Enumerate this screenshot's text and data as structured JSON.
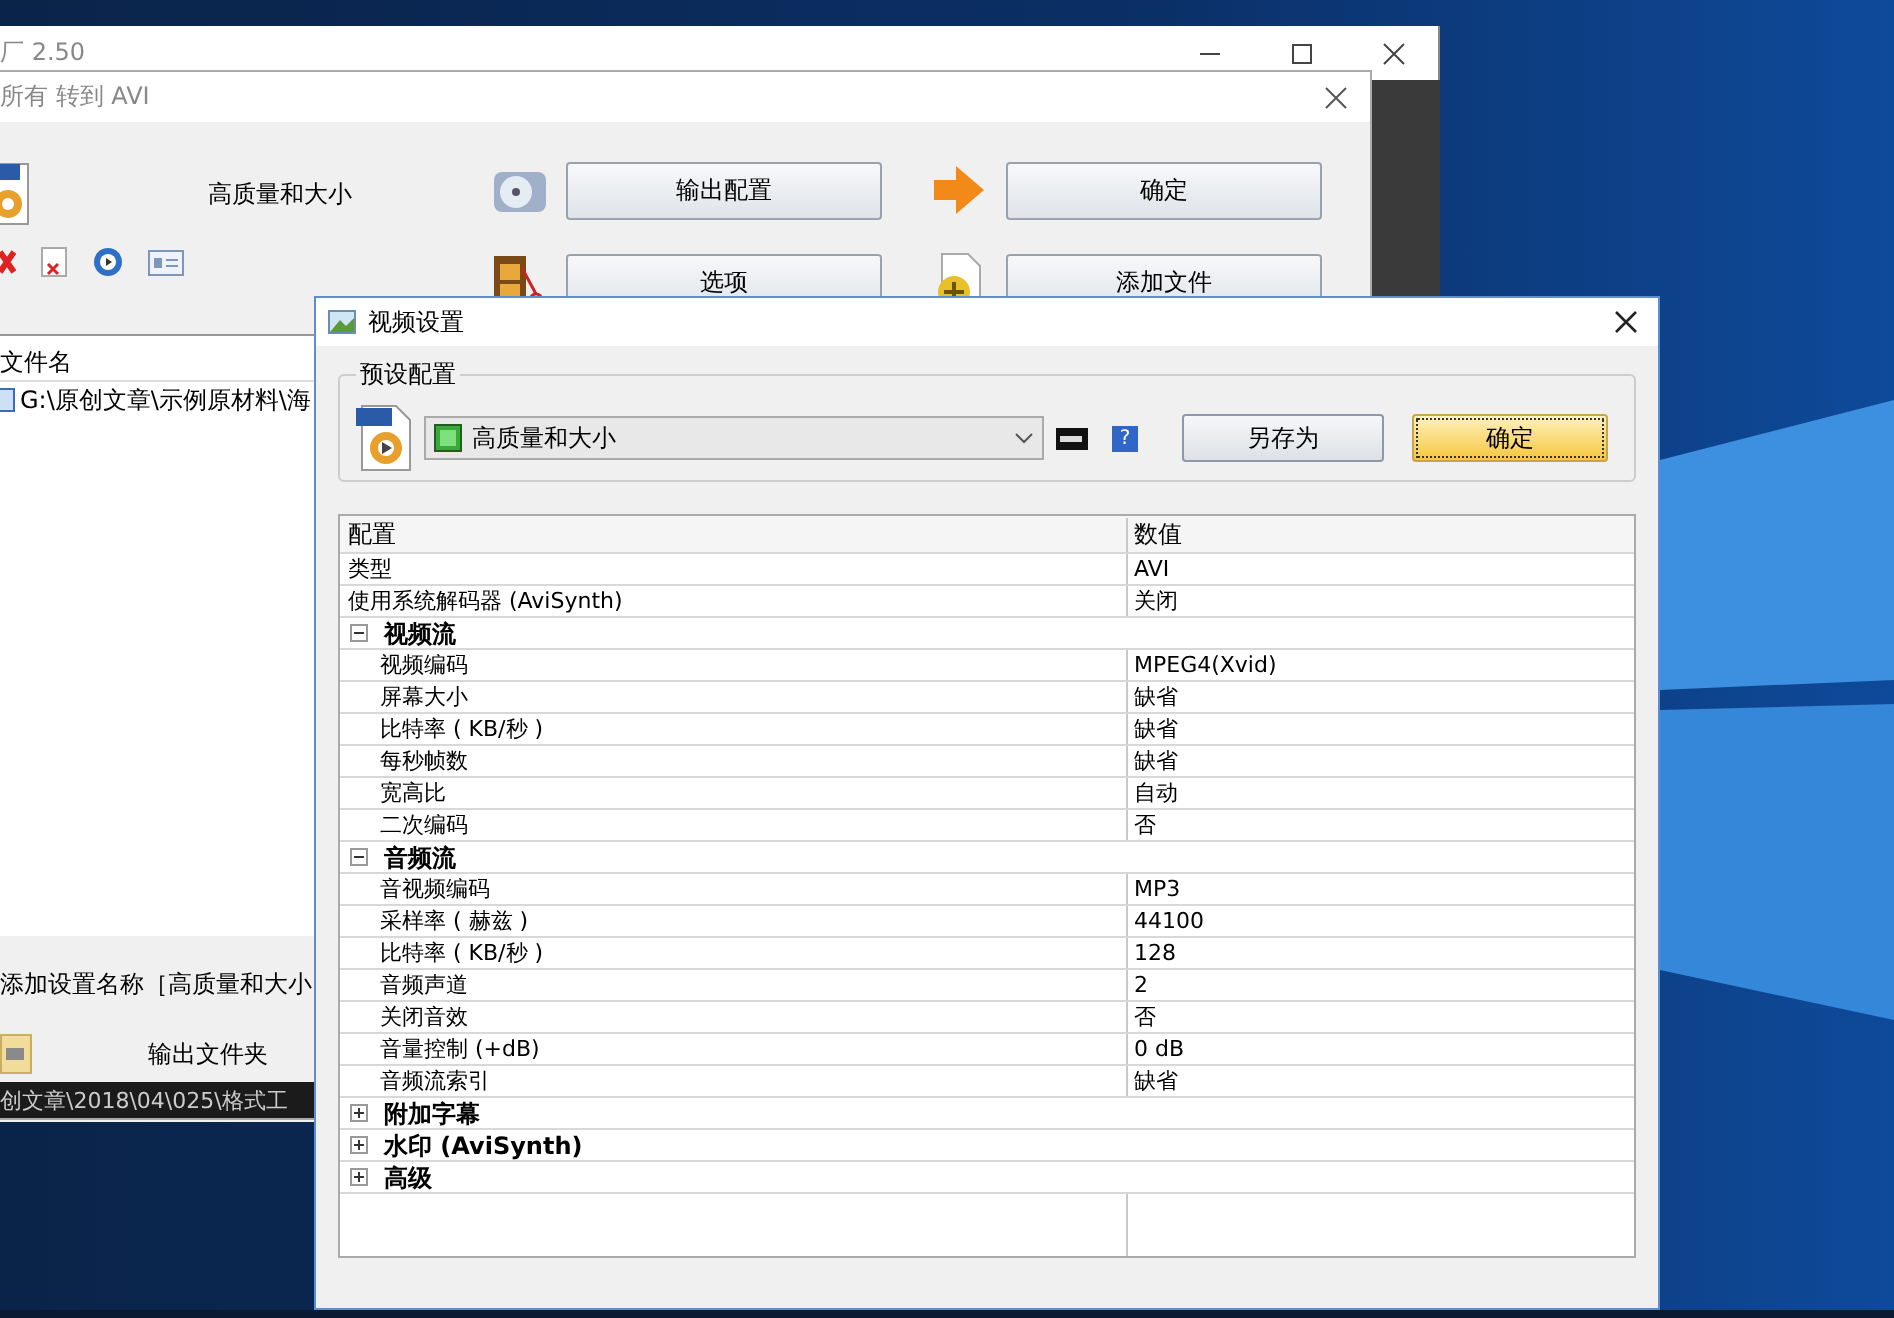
{
  "main_window": {
    "title": "厂 2.50"
  },
  "convert_dialog": {
    "title": "所有 转到 AVI",
    "preset_name": "高质量和大小",
    "actions": [
      {
        "kind": "disc",
        "label": "输出配置"
      },
      {
        "kind": "arrow",
        "label": "确定"
      },
      {
        "kind": "film",
        "label": "选项"
      },
      {
        "kind": "add",
        "label": "添加文件"
      }
    ],
    "file_list": {
      "header": "文件名",
      "rows": [
        "G:\\原创文章\\示例原材料\\海"
      ]
    },
    "settings_name": "添加设置名称［高质量和大小",
    "output_folder": "输出文件夹",
    "path_bar": "创文章\\2018\\04\\025\\格式工"
  },
  "video_settings": {
    "title": "视频设置",
    "group_label": "预设配置",
    "preset": "高质量和大小",
    "help_glyph": "?",
    "buttons": [
      {
        "label": "另存为",
        "focused": false
      },
      {
        "label": "确定",
        "focused": true
      }
    ],
    "grid": {
      "columns": [
        "配置",
        "数值"
      ],
      "rows": [
        {
          "kind": "item",
          "name": "类型",
          "value": "AVI"
        },
        {
          "kind": "item",
          "name": "使用系统解码器 (AviSynth)",
          "value": "关闭"
        },
        {
          "kind": "group",
          "name": "视频流",
          "expanded": true,
          "children": [
            {
              "name": "视频编码",
              "value": "MPEG4(Xvid)"
            },
            {
              "name": "屏幕大小",
              "value": "缺省"
            },
            {
              "name": "比特率 ( KB/秒 )",
              "value": "缺省"
            },
            {
              "name": "每秒帧数",
              "value": "缺省"
            },
            {
              "name": "宽高比",
              "value": "自动"
            },
            {
              "name": "二次编码",
              "value": "否"
            }
          ]
        },
        {
          "kind": "group",
          "name": "音频流",
          "expanded": true,
          "children": [
            {
              "name": "音视频编码",
              "value": "MP3"
            },
            {
              "name": "采样率 ( 赫兹 )",
              "value": "44100"
            },
            {
              "name": "比特率 ( KB/秒 )",
              "value": "128"
            },
            {
              "name": "音频声道",
              "value": "2"
            },
            {
              "name": "关闭音效",
              "value": "否"
            },
            {
              "name": "音量控制 (+dB)",
              "value": "0 dB"
            },
            {
              "name": "音频流索引",
              "value": "缺省"
            }
          ]
        },
        {
          "kind": "group",
          "name": "附加字幕",
          "expanded": false,
          "children": []
        },
        {
          "kind": "group",
          "name": "水印 (AviSynth)",
          "expanded": false,
          "children": []
        },
        {
          "kind": "group",
          "name": "高级",
          "expanded": false,
          "children": []
        }
      ]
    }
  }
}
